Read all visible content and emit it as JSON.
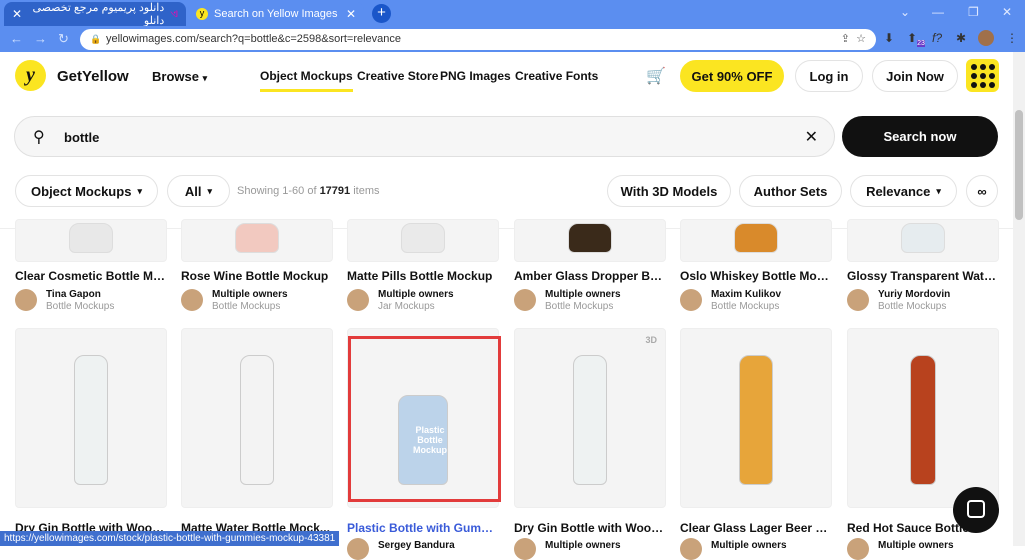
{
  "browser": {
    "tabs": [
      {
        "label": "دانلود پریمیوم مرجع تخصصی دانلو",
        "active": true
      },
      {
        "label": "Search on Yellow Images",
        "active": false
      }
    ],
    "url": "yellowimages.com/search?q=bottle&c=2598&sort=relevance",
    "extension_badge": "23",
    "status_url": "https://yellowimages.com/stock/plastic-bottle-with-gummies-mockup-43381"
  },
  "header": {
    "brand": "GetYellow",
    "browse": "Browse",
    "nav": [
      "Object Mockups",
      "Creative Store",
      "PNG Images",
      "Creative Fonts"
    ],
    "promo": "Get 90% OFF",
    "login": "Log in",
    "join": "Join Now"
  },
  "search": {
    "query": "bottle",
    "button": "Search now"
  },
  "filters": {
    "category": "Object Mockups",
    "scope": "All",
    "showing_prefix": "Showing 1-60 of",
    "total": "17791",
    "showing_suffix": "items",
    "with3d": "With 3D Models",
    "author_sets": "Author Sets",
    "sort": "Relevance"
  },
  "row1": [
    {
      "title": "Clear Cosmetic Bottle Mo...",
      "owner": "Tina Gapon",
      "category": "Bottle Mockups"
    },
    {
      "title": "Rose Wine Bottle Mockup",
      "owner": "Multiple owners",
      "category": "Bottle Mockups"
    },
    {
      "title": "Matte Pills Bottle Mockup",
      "owner": "Multiple owners",
      "category": "Jar Mockups"
    },
    {
      "title": "Amber Glass Dropper Bot...",
      "owner": "Multiple owners",
      "category": "Bottle Mockups"
    },
    {
      "title": "Oslo Whiskey Bottle Moc...",
      "owner": "Maxim Kulikov",
      "category": "Bottle Mockups"
    },
    {
      "title": "Glossy Transparent Water...",
      "owner": "Yuriy Mordovin",
      "category": "Bottle Mockups"
    }
  ],
  "row2": [
    {
      "title": "Dry Gin Bottle with Wood...",
      "owner": "",
      "badge": ""
    },
    {
      "title": "Matte Water Bottle Mock...",
      "owner": "",
      "badge": ""
    },
    {
      "title": "Plastic Bottle with Gumm...",
      "owner": "Sergey Bandura",
      "badge": "",
      "highlighted": true,
      "label": "Plastic Bottle Mockup"
    },
    {
      "title": "Dry Gin Bottle with Wood...",
      "owner": "Multiple owners",
      "badge": "3D"
    },
    {
      "title": "Clear Glass Lager Beer Bo...",
      "owner": "Multiple owners",
      "badge": ""
    },
    {
      "title": "Red Hot Sauce Bottle ...",
      "owner": "Multiple owners",
      "badge": ""
    }
  ],
  "colors": {
    "accent": "#fbe521",
    "tabbar": "#5b8ef0",
    "highlight": "#e23b3b",
    "link": "#3a5bd9"
  }
}
